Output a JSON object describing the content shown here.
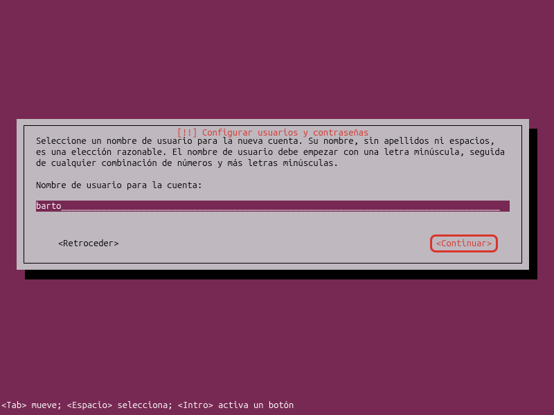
{
  "dialog": {
    "title": "[!!] Configurar usuarios y contraseñas",
    "text": "Seleccione un nombre de usuario para la nueva cuenta. Su nombre, sin apellidos ni espacios, es una elección razonable. El nombre de usuario debe empezar con una letra minúscula, seguida de cualquier combinación de números y más letras minúsculas.",
    "prompt_label": "Nombre de usuario para la cuenta:",
    "input_value": "barto",
    "input_fill": "_______________________________________________________________________________________",
    "back_button": "<Retroceder>",
    "continue_button": "<Continuar>"
  },
  "status_bar": "<Tab> mueve; <Espacio> selecciona; <Intro> activa un botón",
  "colors": {
    "background": "#772953",
    "dialog_bg": "#bfb8bf",
    "accent": "#d9342b"
  }
}
